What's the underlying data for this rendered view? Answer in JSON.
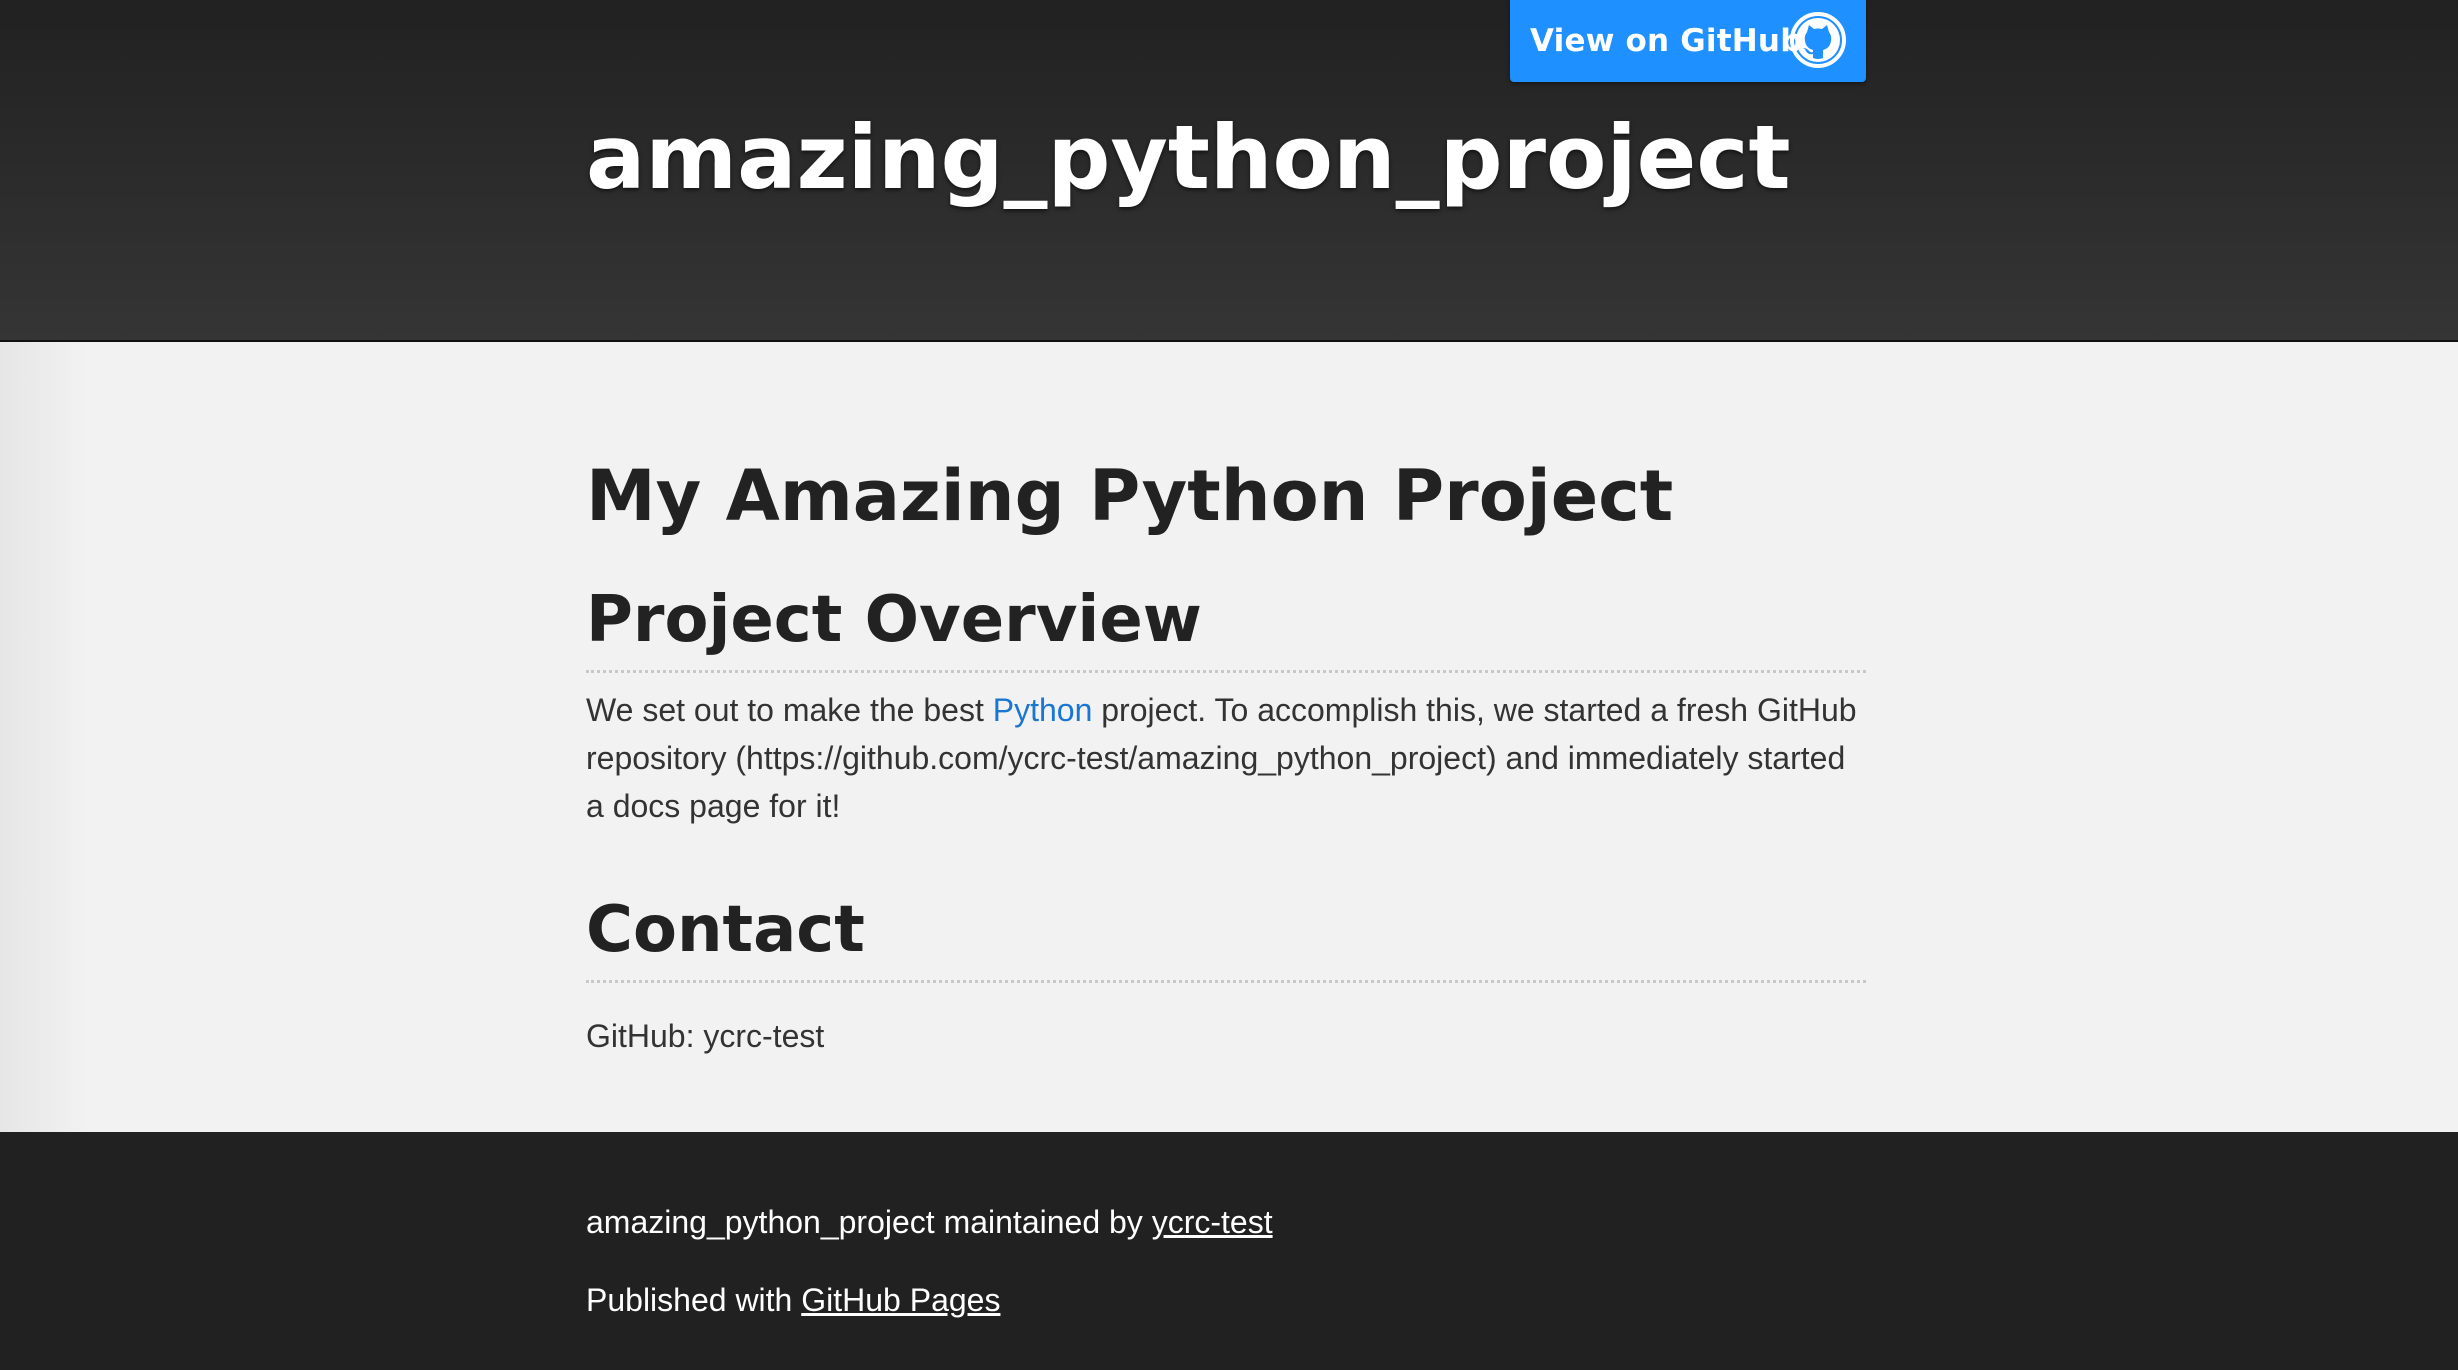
{
  "header": {
    "site_title": "amazing_python_project",
    "github_button_label": "View on GitHub",
    "github_button_icon": "github-octocat-icon"
  },
  "main": {
    "page_heading": "My Amazing Python Project",
    "overview": {
      "heading": "Project Overview",
      "text_before_link": "We set out to make the best ",
      "link_text": "Python",
      "text_after_link": " project. To accomplish this, we started a fresh GitHub repository (https://github.com/ycrc-test/amazing_python_project) and immediately started a docs page for it!"
    },
    "contact": {
      "heading": "Contact",
      "text": "GitHub: ycrc-test"
    }
  },
  "footer": {
    "maintained_prefix": "amazing_python_project maintained by ",
    "maintainer_link": "ycrc-test",
    "published_prefix": "Published with ",
    "published_link": "GitHub Pages"
  },
  "colors": {
    "header_bg": "#212121",
    "button_accent": "#1e90ff",
    "link": "#1976d2",
    "content_bg": "#f2f2f2"
  }
}
